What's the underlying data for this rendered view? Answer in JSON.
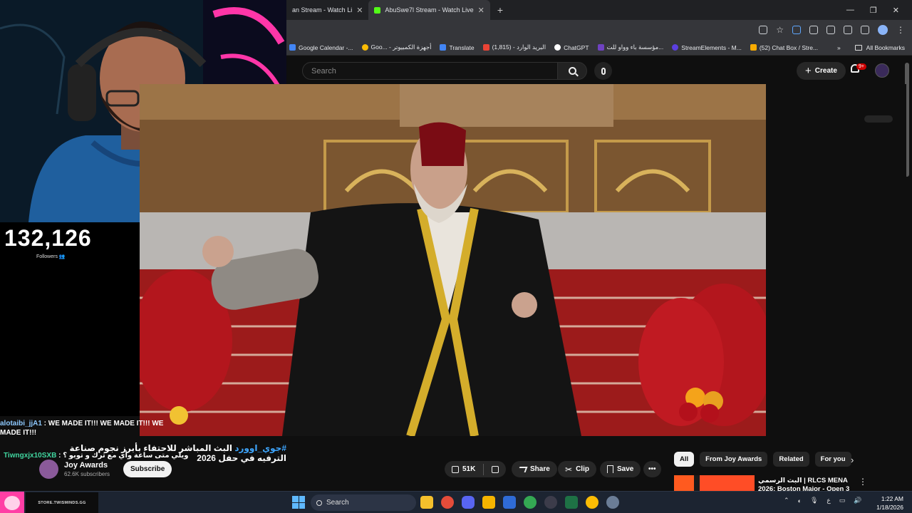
{
  "browser": {
    "tabs": [
      {
        "label": "an Stream - Watch Li",
        "active": false
      },
      {
        "label": "AbuSwe7l Stream - Watch Live",
        "active": true
      }
    ],
    "bookmarks": [
      {
        "label": "Google Calendar -...",
        "icon": "calendar-icon"
      },
      {
        "label": "Goo... - أجهزة الكمبيوتر",
        "icon": "google-icon"
      },
      {
        "label": "Translate",
        "icon": "translate-icon"
      },
      {
        "label": "البريد الوارد - (1,815)",
        "icon": "gmail-icon"
      },
      {
        "label": "ChatGPT",
        "icon": "chatgpt-icon"
      },
      {
        "label": "مؤسسة باء وواو للت...",
        "icon": "web-icon"
      },
      {
        "label": "StreamElements - M...",
        "icon": "streamelements-icon"
      },
      {
        "label": "(52) Chat Box / Stre...",
        "icon": "chatbox-icon"
      }
    ],
    "all_bookmarks": "All Bookmarks"
  },
  "youtube": {
    "search_placeholder": "Search",
    "create_label": "Create",
    "notifications_badge": "9+",
    "video_title_tag": "#جوي_اوورد",
    "video_title_text": "البث المباشر للاحتفاء بأبرز نجوم صناعة الترفيه في حفل 2026",
    "channel_name": "Joy Awards",
    "channel_subs": "62.6K subscribers",
    "subscribe_label": "Subscribe",
    "like_count": "51K",
    "share_label": "Share",
    "clip_label": "Clip",
    "save_label": "Save",
    "more_label": "•••",
    "chips": [
      "All",
      "From Joy Awards",
      "Related",
      "For you"
    ],
    "rec_title": "البث الرسمي | RLCS MENA 2026: Boston Major - Open 3 |"
  },
  "overlay": {
    "followers_count": "132,126",
    "followers_label": "Followers 👥",
    "chat": [
      {
        "user": "alotaibi_jjA1",
        "message": " : WE MADE IT!!! WE MADE IT!!! WE MADE IT!!!"
      },
      {
        "user": "Tiwngxjx10SXB",
        "message": " : ويلي متى ساعة وأي مع ترك و توبو ؟"
      }
    ]
  },
  "taskbar": {
    "store_label": "STORE.TWISMINDS.GG",
    "search_label": "Search",
    "time": "1:22 AM",
    "date": "1/18/2026",
    "lang": "ع"
  }
}
